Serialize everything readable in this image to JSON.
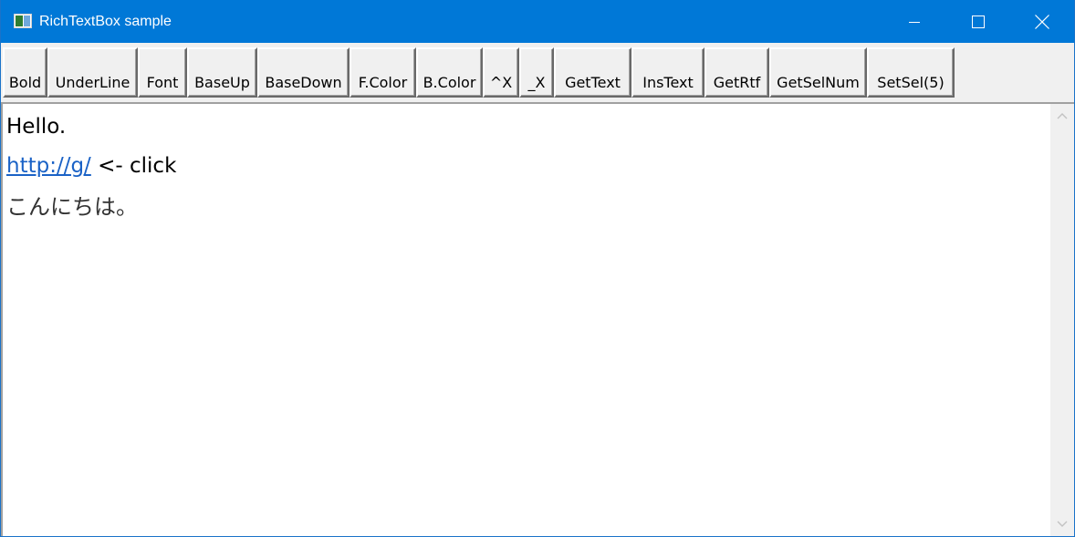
{
  "window": {
    "title": "RichTextBox sample"
  },
  "toolbar": {
    "buttons": [
      {
        "label": "Bold"
      },
      {
        "label": "UnderLine"
      },
      {
        "label": "Font"
      },
      {
        "label": "BaseUp"
      },
      {
        "label": "BaseDown"
      },
      {
        "label": "F.Color"
      },
      {
        "label": "B.Color"
      },
      {
        "label": "^X"
      },
      {
        "label": "_X"
      },
      {
        "label": "GetText"
      },
      {
        "label": "InsText"
      },
      {
        "label": "GetRtf"
      },
      {
        "label": "GetSelNum"
      },
      {
        "label": "SetSel(5)"
      }
    ]
  },
  "editor": {
    "line1": "Hello.",
    "line2_link": "http://g/",
    "line2_rest": " <- click",
    "line3": "こんにちは。"
  },
  "colors": {
    "titlebar": "#0078d7",
    "link": "#1a62c6"
  }
}
